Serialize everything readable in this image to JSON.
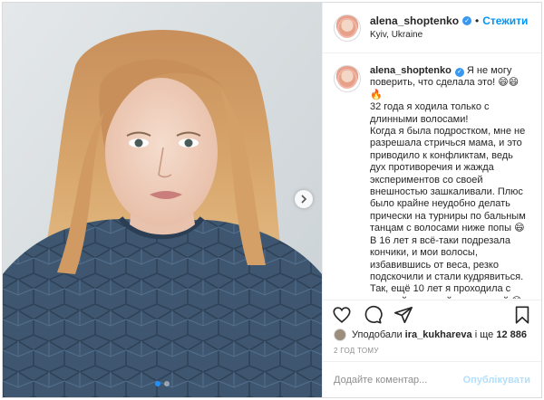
{
  "post": {
    "username": "alena_shoptenko",
    "separator": "•",
    "follow_label": "Стежити",
    "location": "Kyiv, Ukraine",
    "verified_glyph": "✓"
  },
  "caption": {
    "username": "alena_shoptenko",
    "text": " Я не могу поверить, что сделала это! 😄😄🔥\n32 года я ходила только с длинными волосами!\nКогда я была подростком, мне не разрешала стричься мама, и это приводило к конфликтам, ведь дух противоречия и жажда экспериментов со своей внешностью зашкаливали. Плюс было крайне неудобно делать прически на турниры по бальным танцам с волосами ниже попы 😄\nВ 16 лет я всё-таки подрезала кончики, и мои волосы, избавившись от веса, резко подскочили и стали кудрявиться. Так, ещё 10 лет я проходила с пышной кудрявой шевелюрой 😊\nНу, а что касается последних..."
  },
  "likes": {
    "prefix": "Уподобали",
    "user": "ira_kukhareva",
    "conjunction": "і ще",
    "count": "12 886"
  },
  "timestamp": "2 год тому",
  "comment": {
    "placeholder": "Додайте коментар...",
    "publish_label": "Опублікувати"
  },
  "carousel": {
    "total": 2,
    "active": 1
  },
  "colors": {
    "accent": "#0095f6",
    "verified": "#3897f0",
    "publish_disabled": "#b2dffc",
    "sweater": "#3f5670"
  },
  "icons": [
    "heart-icon",
    "comment-icon",
    "share-icon",
    "bookmark-icon",
    "chevron-right-icon",
    "verified-icon"
  ]
}
